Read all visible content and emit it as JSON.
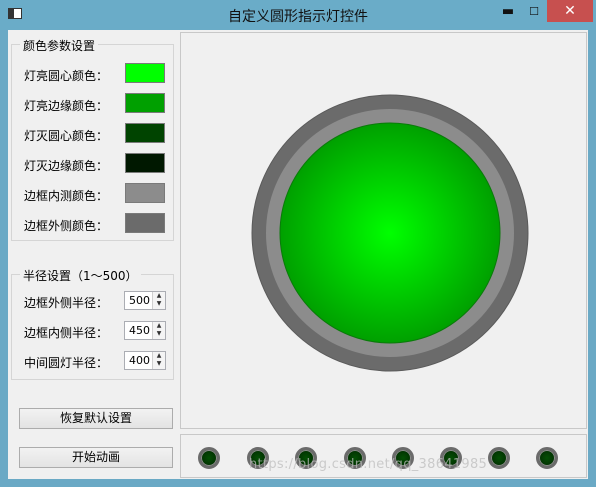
{
  "window": {
    "title": "自定义圆形指示灯控件",
    "min_glyph": "▬",
    "max_glyph": "☐",
    "close_glyph": "✕"
  },
  "color_group": {
    "title": "颜色参数设置",
    "items": [
      {
        "label": "灯亮圆心颜色：",
        "color": "#00ff00"
      },
      {
        "label": "灯亮边缘颜色：",
        "color": "#00a000"
      },
      {
        "label": "灯灭圆心颜色：",
        "color": "#004400"
      },
      {
        "label": "灯灭边缘颜色：",
        "color": "#001800"
      },
      {
        "label": "边框内测颜色：",
        "color": "#8c8c8c"
      },
      {
        "label": "边框外侧颜色：",
        "color": "#6b6b6b"
      }
    ]
  },
  "radius_group": {
    "title": "半径设置（1～500）",
    "items": [
      {
        "label": "边框外侧半径：",
        "value": "500"
      },
      {
        "label": "边框内侧半径：",
        "value": "450"
      },
      {
        "label": "中间圆灯半径：",
        "value": "400"
      }
    ]
  },
  "buttons": {
    "reset": "恢复默认设置",
    "animate": "开始动画"
  },
  "indicator": {
    "outer_color": "#6b6b6b",
    "inner_color": "#8c8c8c",
    "center_color": "#00ff00",
    "edge_color": "#00a000",
    "state": "on"
  },
  "led_row": {
    "count": 8,
    "state": "off"
  },
  "watermark": "https://blog.csdn.net/qq_38641985"
}
